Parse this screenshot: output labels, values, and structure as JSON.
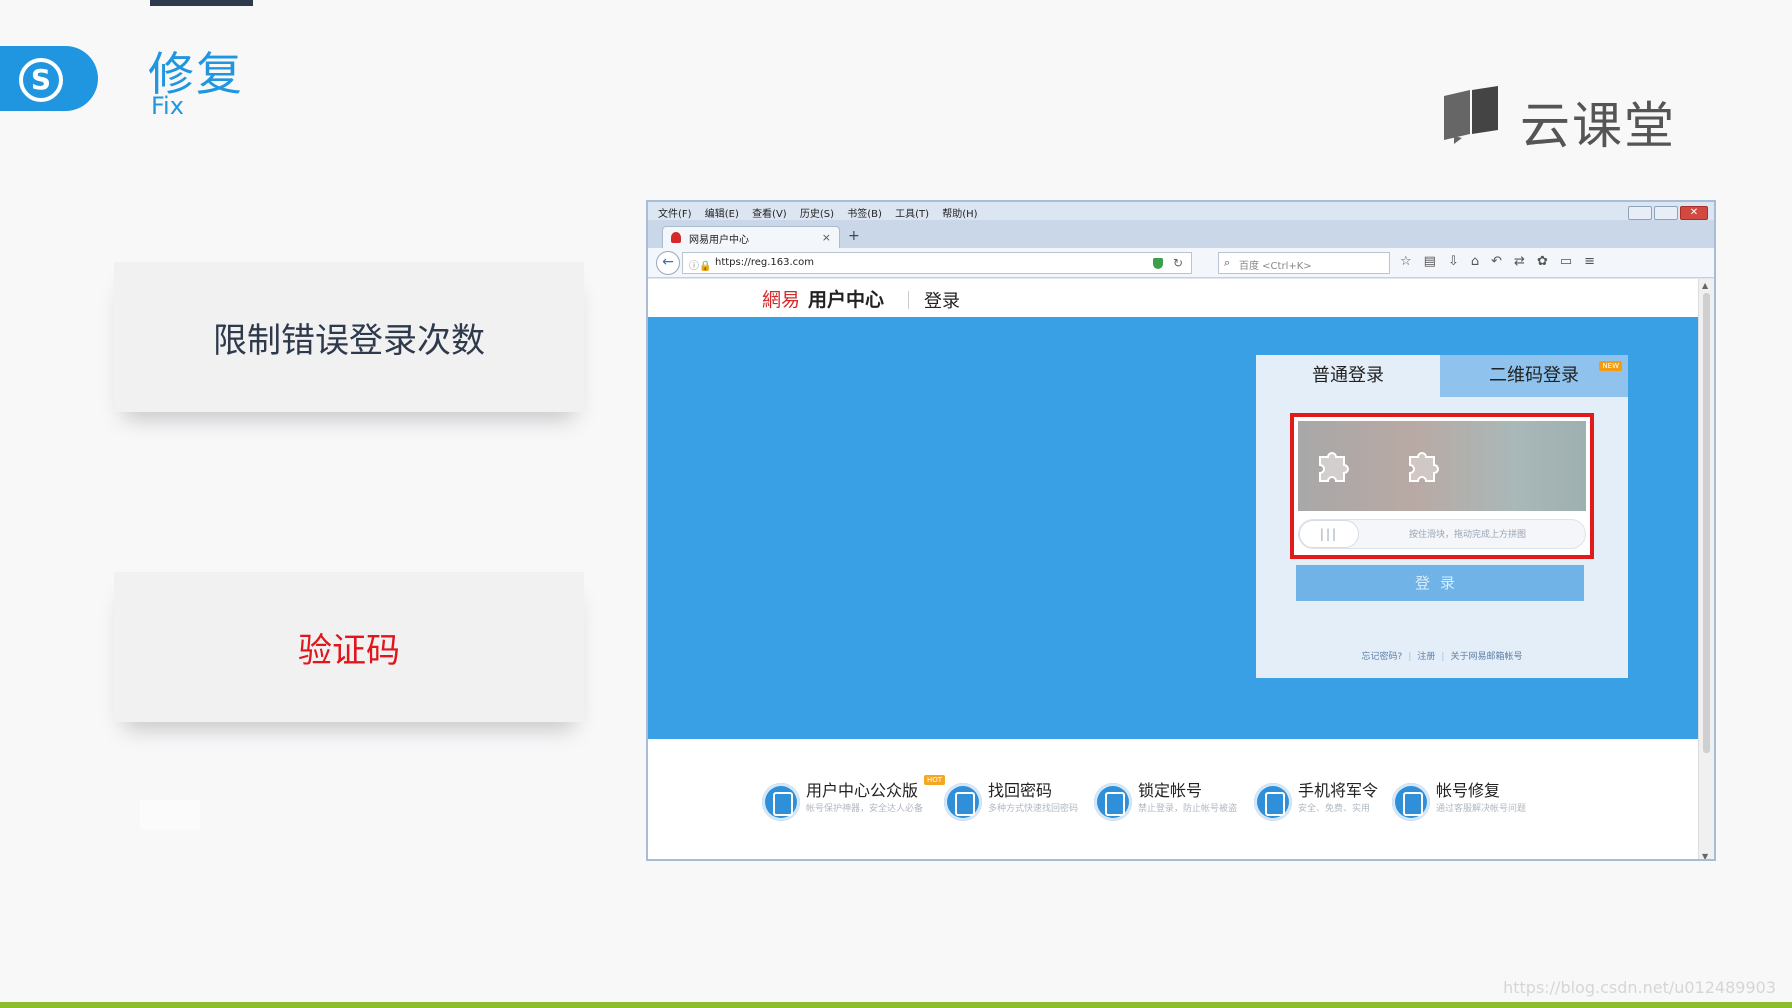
{
  "slide": {
    "section_zh": "修复",
    "section_en": "Fix",
    "brand_name": "云课堂",
    "logo_letter": "S",
    "cards": [
      {
        "text": "限制错误登录次数",
        "color": "#2e3a4c"
      },
      {
        "text": "验证码",
        "color": "#e0161c"
      }
    ],
    "watermark": "https://blog.csdn.net/u012489903",
    "accent_color": "#2196e0"
  },
  "browser": {
    "menu": [
      "文件(F)",
      "编辑(E)",
      "查看(V)",
      "历史(S)",
      "书签(B)",
      "工具(T)",
      "帮助(H)"
    ],
    "tab_title": "网易用户中心",
    "tab_close": "×",
    "new_tab": "+",
    "url": "https://reg.163.com",
    "search_placeholder": "百度 <Ctrl+K>",
    "back_glyph": "←",
    "reload_glyph": "C",
    "toolbar_icons": [
      "star-icon",
      "clipboard-icon",
      "download-icon",
      "home-icon",
      "undo-icon",
      "share-icon",
      "addon-icon",
      "screen-icon",
      "menu-icon"
    ]
  },
  "site": {
    "logo": "網易",
    "name": "用户中心",
    "page": "登录",
    "banner_color": "#39a0e6",
    "login_panel": {
      "tab_normal": "普通登录",
      "tab_qr": "二维码登录",
      "qr_badge": "NEW",
      "slider_handle": "|||",
      "slider_hint": "按住滑块，拖动完成上方拼图",
      "login_button": "登录",
      "links": [
        "忘记密码?",
        "注册",
        "关于网易邮箱帐号"
      ]
    },
    "services": [
      {
        "name": "用户中心公众版",
        "desc": "帐号保护神器，安全达人必备",
        "badge": "HOT"
      },
      {
        "name": "找回密码",
        "desc": "多种方式快速找回密码",
        "badge": ""
      },
      {
        "name": "锁定帐号",
        "desc": "禁止登录，防止帐号被盗",
        "badge": ""
      },
      {
        "name": "手机将军令",
        "desc": "安全、免费、实用",
        "badge": ""
      },
      {
        "name": "帐号修复",
        "desc": "通过客服解决帐号问题",
        "badge": ""
      }
    ]
  }
}
